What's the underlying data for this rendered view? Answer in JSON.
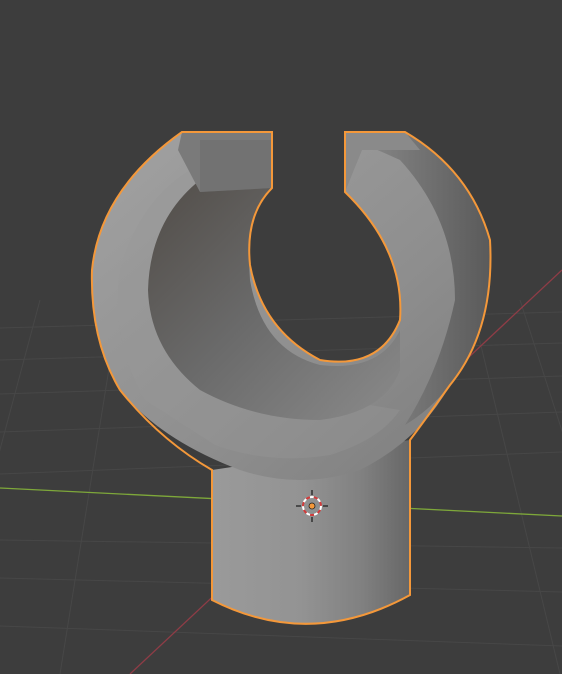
{
  "viewport": {
    "background_color": "#3d3d3d",
    "grid_color": "#4a4a4a",
    "x_axis_color": "#8ab834",
    "y_axis_color": "#9e3f4a"
  },
  "object": {
    "name": "",
    "selected": true,
    "outline_color": "#f4983a",
    "base_color": "#8c8c8c"
  },
  "origin_marker": {
    "icon": "origin-dot-icon",
    "color": "#f4983a"
  },
  "cursor_3d": {
    "icon": "crosshair-3d-cursor-icon",
    "ring_colors": [
      "#ffffff",
      "#d23b3b"
    ]
  }
}
